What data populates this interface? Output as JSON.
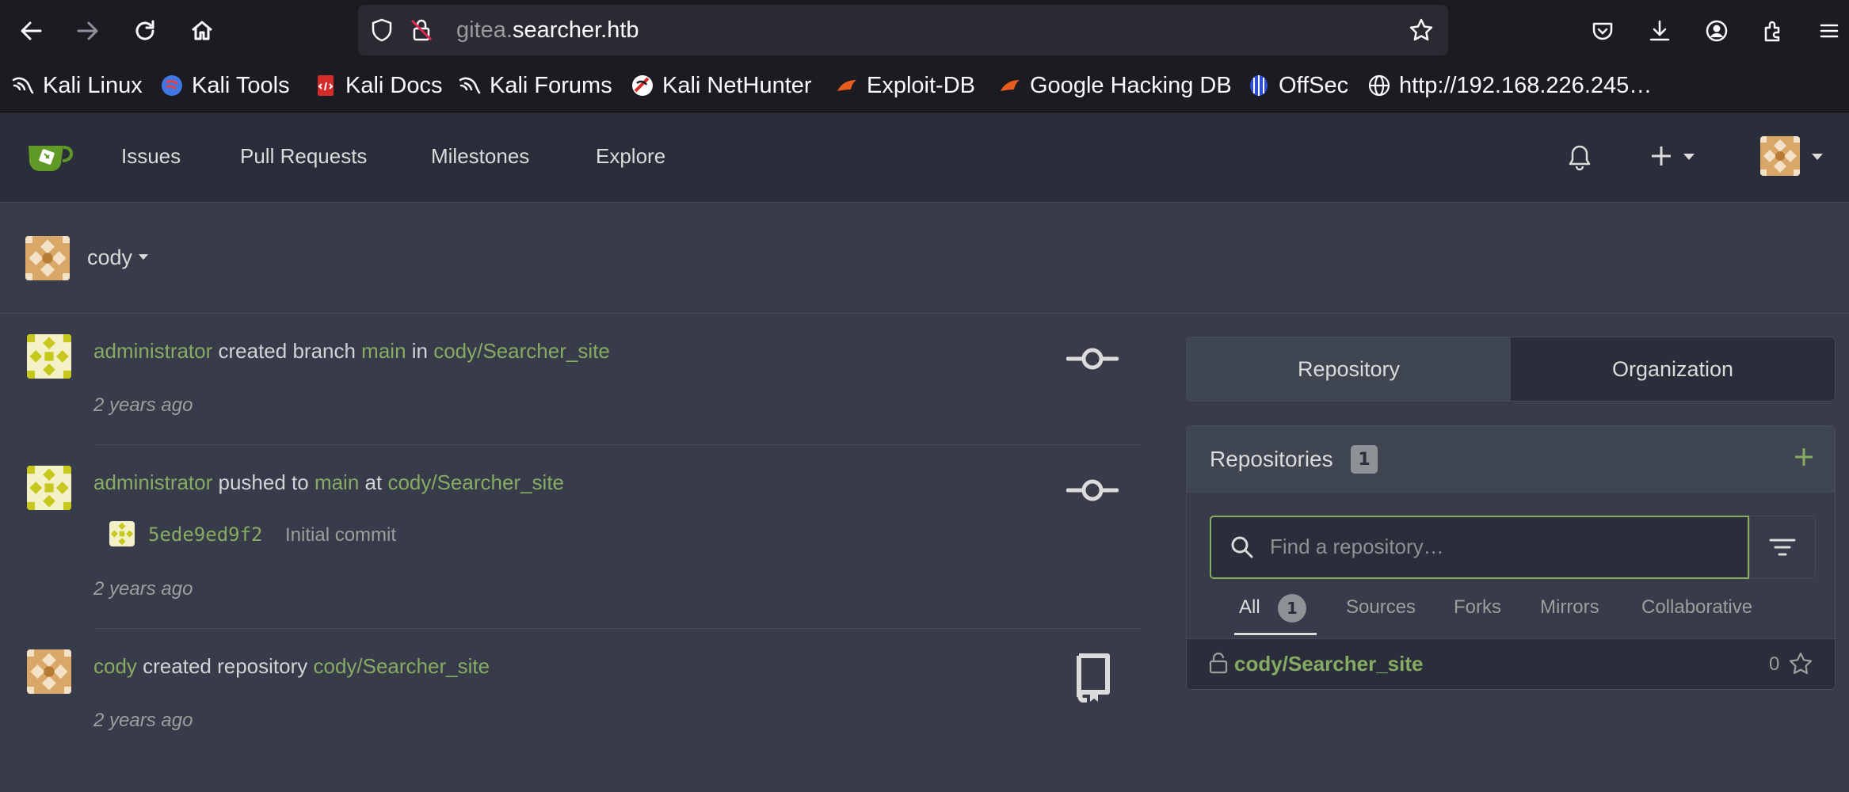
{
  "browser": {
    "url_host_prefix": "gitea.",
    "url_host_main": "searcher.htb",
    "bookmarks": [
      {
        "label": "Kali Linux",
        "icon": "kali-dragon-icon"
      },
      {
        "label": "Kali Tools",
        "icon": "kali-tools-icon"
      },
      {
        "label": "Kali Docs",
        "icon": "kali-docs-icon"
      },
      {
        "label": "Kali Forums",
        "icon": "kali-dragon-icon"
      },
      {
        "label": "Kali NetHunter",
        "icon": "nethunter-icon"
      },
      {
        "label": "Exploit-DB",
        "icon": "exploitdb-icon"
      },
      {
        "label": "Google Hacking DB",
        "icon": "ghdb-icon"
      },
      {
        "label": "OffSec",
        "icon": "offsec-icon"
      },
      {
        "label": "http://192.168.226.245…",
        "icon": "globe-icon"
      }
    ]
  },
  "nav": {
    "links": [
      "Issues",
      "Pull Requests",
      "Milestones",
      "Explore"
    ]
  },
  "context": {
    "user": "cody"
  },
  "feed": [
    {
      "actor": "administrator",
      "action": " created branch ",
      "ref": "main",
      "prep": " in ",
      "repo": "cody/Searcher_site",
      "time": "2 years ago"
    },
    {
      "actor": "administrator",
      "action": " pushed to ",
      "ref": "main",
      "prep": " at ",
      "repo": "cody/Searcher_site",
      "commit_sha": "5ede9ed9f2",
      "commit_msg": "Initial commit",
      "time": "2 years ago"
    },
    {
      "actor": "cody",
      "action": " created repository ",
      "repo": "cody/Searcher_site",
      "time": "2 years ago"
    }
  ],
  "panel": {
    "tab_repository": "Repository",
    "tab_organization": "Organization",
    "repos_title": "Repositories",
    "repos_count": "1",
    "search_placeholder": "Find a repository…",
    "filters": [
      "All",
      "Sources",
      "Forks",
      "Mirrors",
      "Collaborative"
    ],
    "all_count": "1",
    "repo_name": "cody/Searcher_site",
    "repo_stars": "0"
  },
  "colors": {
    "accent_green": "#87ab63",
    "background": "#383c4a",
    "navbar": "#2a2e3a"
  }
}
